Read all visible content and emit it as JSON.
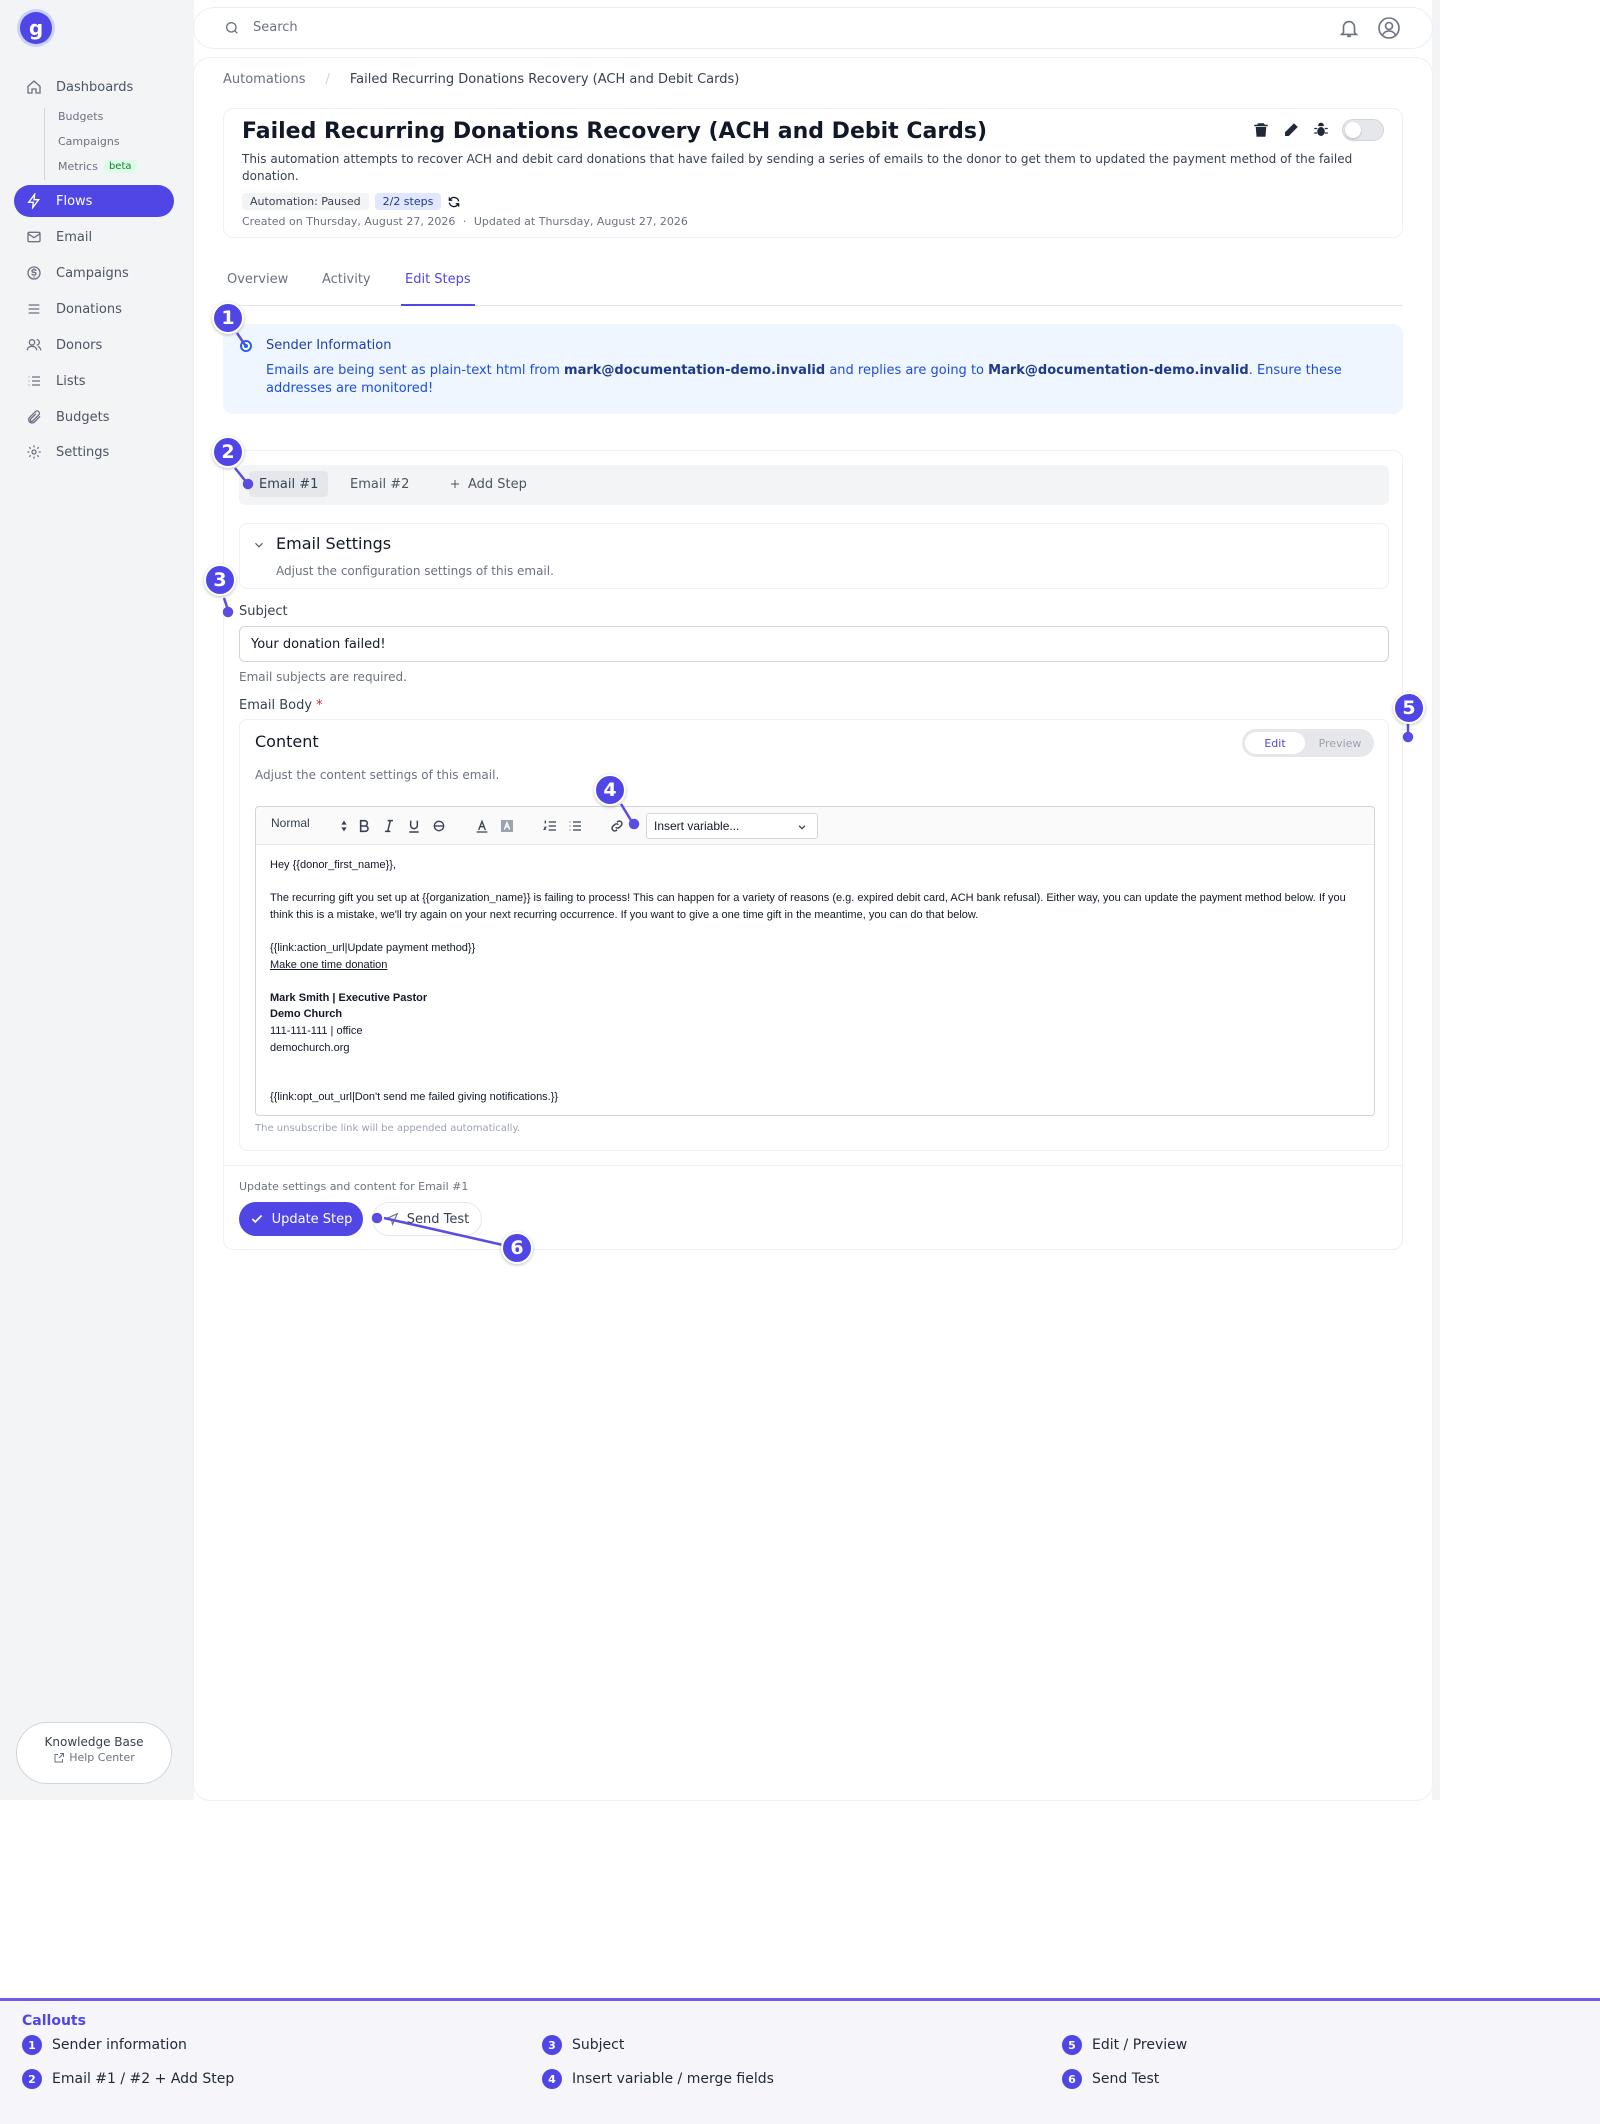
{
  "app": {
    "logo_letter": "g",
    "brand_color": "#4f46e5"
  },
  "sidebar": {
    "items": [
      {
        "label": "Dashboards",
        "icon": "home-icon"
      },
      {
        "label": "Flows",
        "icon": "bolt-icon",
        "active": true
      },
      {
        "label": "Email",
        "icon": "mail-icon"
      },
      {
        "label": "Campaigns",
        "icon": "dollar-icon"
      },
      {
        "label": "Donations",
        "icon": "list-icon"
      },
      {
        "label": "Donors",
        "icon": "users-icon"
      },
      {
        "label": "Lists",
        "icon": "bullets-icon"
      },
      {
        "label": "Budgets",
        "icon": "paperclip-icon"
      },
      {
        "label": "Settings",
        "icon": "gear-icon"
      }
    ],
    "sub_items": [
      {
        "label": "Budgets"
      },
      {
        "label": "Campaigns"
      },
      {
        "label": "Metrics",
        "badge": "beta"
      }
    ],
    "knowledge_base": {
      "title": "Knowledge Base",
      "subtitle": "Help Center"
    }
  },
  "topbar": {
    "search_placeholder": "Search"
  },
  "breadcrumb": {
    "parent": "Automations",
    "separator": "/",
    "current": "Failed Recurring Donations Recovery (ACH and Debit Cards)"
  },
  "header": {
    "title": "Failed Recurring Donations Recovery (ACH and Debit Cards)",
    "description": "This automation attempts to recover ACH and debit card donations that have failed by sending a series of emails to the donor to get them to updated the payment method of the failed donation.",
    "status_badge": "Automation: Paused",
    "steps_badge": "2/2 steps",
    "created": "Created on Thursday, August 27, 2026",
    "dot": "·",
    "updated": "Updated at Thursday, August 27, 2026",
    "enabled": false
  },
  "tabs": [
    {
      "label": "Overview"
    },
    {
      "label": "Activity"
    },
    {
      "label": "Edit Steps",
      "active": true
    }
  ],
  "sender": {
    "title": "Sender Information",
    "text_1": "Emails are being sent as plain-text html from ",
    "from": "mark@documentation-demo.invalid",
    "text_2": " and replies are going to ",
    "reply_to": "Mark@documentation-demo.invalid",
    "text_3": ". Ensure these addresses are monitored!"
  },
  "steps": {
    "tabs": [
      {
        "label": "Email #1",
        "active": true
      },
      {
        "label": "Email #2"
      }
    ],
    "add_label": "Add Step"
  },
  "email_settings": {
    "title": "Email Settings",
    "description": "Adjust the configuration settings of this email.",
    "subject_label": "Subject",
    "subject_value": "Your donation failed!",
    "subject_hint": "Email subjects are required.",
    "body_label": "Email Body",
    "required_mark": "*"
  },
  "content": {
    "title": "Content",
    "description": "Adjust the content settings of this email.",
    "mode_edit": "Edit",
    "mode_preview": "Preview",
    "active_mode": "Edit",
    "toolbar": {
      "format": "Normal",
      "variable_select": "Insert variable..."
    },
    "body": {
      "greeting": "Hey {{donor_first_name}},",
      "paragraph": "The recurring gift you set up at {{organization_name}} is failing to process! This can happen for a variety of reasons (e.g. expired debit card, ACH bank refusal). Either way, you can update the payment method below. If you think this is a mistake, we'll try again on your next recurring occurrence. If you want to give a one time gift in the meantime, you can do that below.",
      "action_link": "{{link:action_url|Update payment method}}",
      "one_time_link": "Make one time donation",
      "sig_name": "Mark Smith | Executive Pastor",
      "sig_org": "Demo Church",
      "sig_phone": "111-111-111 | office",
      "sig_site": "demochurch.org",
      "opt_out": "{{link:opt_out_url|Don't send me failed giving notifications.}}"
    },
    "footer_note": "The unsubscribe link will be appended automatically."
  },
  "actions": {
    "hint": "Update settings and content for Email #1",
    "update_label": "Update Step",
    "test_label": "Send Test"
  },
  "markers": [
    "1",
    "2",
    "3",
    "4",
    "5",
    "6"
  ],
  "callouts": {
    "title": "Callouts",
    "items": [
      {
        "num": "1",
        "label": "Sender information"
      },
      {
        "num": "2",
        "label": "Email #1 / #2 + Add Step"
      },
      {
        "num": "3",
        "label": "Subject"
      },
      {
        "num": "4",
        "label": "Insert variable / merge fields"
      },
      {
        "num": "5",
        "label": "Edit / Preview"
      },
      {
        "num": "6",
        "label": "Send Test"
      }
    ]
  }
}
